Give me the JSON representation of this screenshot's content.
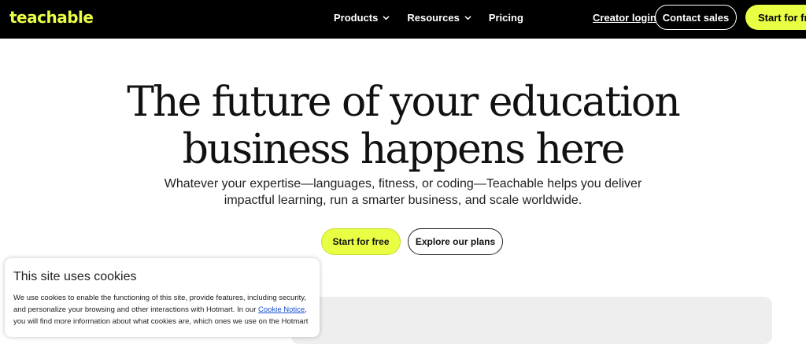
{
  "header": {
    "logo": "teachable",
    "nav": [
      {
        "label": "Products",
        "has_dropdown": true
      },
      {
        "label": "Resources",
        "has_dropdown": true
      },
      {
        "label": "Pricing",
        "has_dropdown": false
      }
    ],
    "creator_login": "Creator login",
    "contact_sales": "Contact sales",
    "start_free": "Start for free"
  },
  "hero": {
    "title_line1": "The future of your education",
    "title_line2": "business happens here",
    "subtitle_line1": "Whatever your expertise—languages, fitness, or coding—Teachable helps you deliver",
    "subtitle_line2": "impactful learning, run a smarter business, and scale worldwide.",
    "cta_primary": "Start for free",
    "cta_secondary": "Explore our plans"
  },
  "cookie": {
    "title": "This site uses cookies",
    "text_before_link": "We use cookies to enable the functioning of this site, provide features, including security, and personalize your browsing and other interactions with Hotmart. In our ",
    "link": "Cookie Notice",
    "text_after_link": ", you will find more information about what cookies are, which ones we use on the Hotmart"
  },
  "colors": {
    "brand_accent": "#e9ff44",
    "header_bg": "#000000"
  }
}
